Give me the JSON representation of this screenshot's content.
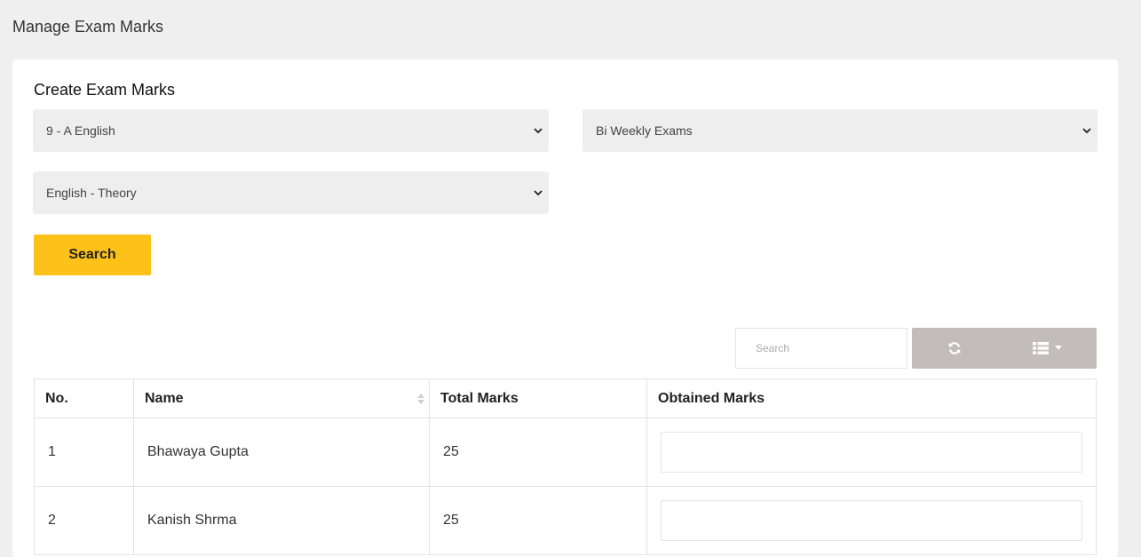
{
  "page": {
    "title": "Manage Exam Marks"
  },
  "form": {
    "title": "Create Exam Marks",
    "class_select": {
      "selected": "9 - A English"
    },
    "exam_select": {
      "selected": "Bi Weekly Exams"
    },
    "subject_select": {
      "selected": "English - Theory"
    },
    "search_button": "Search"
  },
  "toolbar": {
    "search_placeholder": "Search",
    "refresh_icon": "refresh-icon",
    "columns_icon": "list-columns-icon"
  },
  "table": {
    "headers": [
      "No.",
      "Name",
      "Total Marks",
      "Obtained Marks"
    ],
    "rows": [
      {
        "no": "1",
        "name": "Bhawaya Gupta",
        "total": "25",
        "obtained": ""
      },
      {
        "no": "2",
        "name": "Kanish Shrma",
        "total": "25",
        "obtained": ""
      }
    ]
  },
  "colors": {
    "background": "#efefef",
    "card": "#ffffff",
    "accent_button": "#fdc21a",
    "toolbar_buttons": "#c2bcbc",
    "select_bg": "#eeeeee"
  }
}
